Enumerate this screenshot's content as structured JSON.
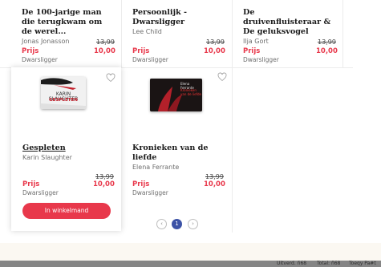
{
  "products": [
    {
      "title": "De 100-jarige man die terugkwam om de werel...",
      "author": "Jonas Jonasson",
      "old_price": "13,99",
      "prijs_label": "Prijs",
      "price": "10,00",
      "binding": "Dwarsligger"
    },
    {
      "title": "Persoonlijk - Dwarsligger",
      "author": "Lee Child",
      "old_price": "13,99",
      "prijs_label": "Prijs",
      "price": "10,00",
      "binding": "Dwarsligger"
    },
    {
      "title": "De druivenfluisteraar & De geluksvogel",
      "author": "Ilja Gort",
      "old_price": "13,99",
      "prijs_label": "Prijs",
      "price": "10,00",
      "binding": "Dwarsligger"
    },
    {
      "title": "Gespleten",
      "author": "Karin Slaughter",
      "old_price": "13,99",
      "prijs_label": "Prijs",
      "price": "10,00",
      "binding": "Dwarsligger",
      "cover_author": "KARIN SLAUGHTER",
      "cover_title": "GESPLETEN",
      "button_label": "In winkelmand"
    },
    {
      "title": "Kronieken van de liefde",
      "author": "Elena Ferrante",
      "old_price": "13,99",
      "prijs_label": "Prijs",
      "price": "10,00",
      "binding": "Dwarsligger",
      "cover_author": "Elena Ferrante",
      "cover_title": "Kronieken van de liefde"
    }
  ],
  "pagination": {
    "prev": "‹",
    "current": "1",
    "next": "›"
  },
  "status_bar": {
    "left": "Uitverd. ñ68",
    "mid": "Total: ñ68",
    "right": "Toeqy Pa#t"
  },
  "colors": {
    "accent": "#e8384b",
    "pager": "#3c52a6",
    "footer": "#fbf8f2"
  },
  "icons": {
    "wishlist": "heart-outline-icon"
  }
}
